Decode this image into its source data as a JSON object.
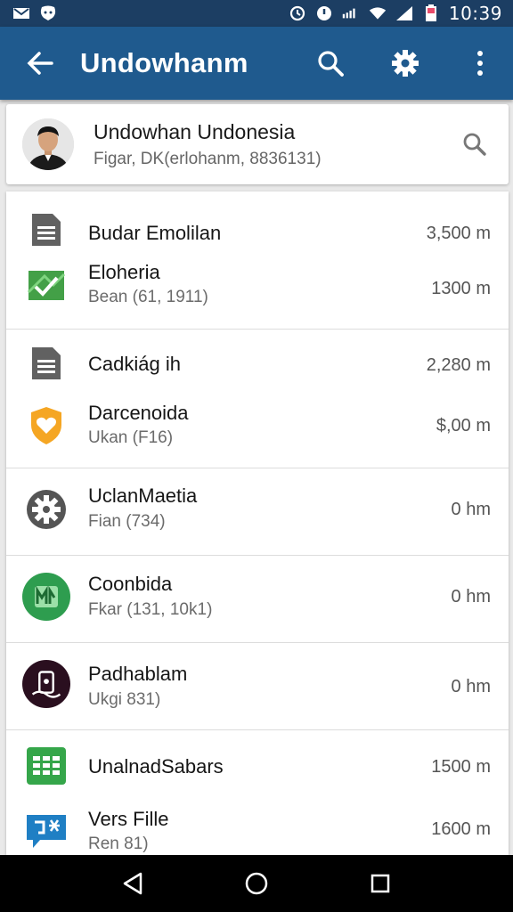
{
  "status_bar": {
    "time": "10:39",
    "left_icons": [
      "mail-icon",
      "notification-icon"
    ],
    "right_icons": [
      "alarm-icon",
      "data-icon",
      "network-speed-icon",
      "wifi-icon",
      "signal-icon",
      "battery-icon"
    ]
  },
  "app_bar": {
    "title": "Undowhanm",
    "actions": [
      "search-icon",
      "settings-icon",
      "more-vert-icon"
    ]
  },
  "profile": {
    "name": "Undowhan Undonesia",
    "subtitle": "Figar, DK(erlohanm, 8836131)"
  },
  "items": [
    {
      "label": "Budar Emolilan",
      "sub": "",
      "value": "3,500 m",
      "icon": "document-icon",
      "icon_color": "#616161"
    },
    {
      "label": "Eloheria",
      "sub": "Bean (61, 1911)",
      "value": "1300 m",
      "icon": "check-image-icon",
      "icon_color": "#43a047"
    },
    {
      "label": "Cadkiág ih",
      "sub": "",
      "value": "2,280 m",
      "icon": "document-icon",
      "icon_color": "#616161"
    },
    {
      "label": "Darcenoida",
      "sub": "Ukan (F16)",
      "value": "$,00 m",
      "icon": "heart-badge-icon",
      "icon_color": "#f5a623"
    },
    {
      "label": "UclanMaetia",
      "sub": "Fian (734)",
      "value": "0 hm",
      "icon": "gear-icon",
      "icon_color": "#555555"
    },
    {
      "label": "Coonbida",
      "sub": "Fkar (131, 10k1)",
      "value": "0 hm",
      "icon": "map-app-icon",
      "icon_color": "#2e9d4f"
    },
    {
      "label": "Padhablam",
      "sub": "Ukgi 831)",
      "value": "0 hm",
      "icon": "phone-app-icon",
      "icon_color": "#2a0f1f"
    },
    {
      "label": "UnalnadSabars",
      "sub": "",
      "value": "1500 m",
      "icon": "grid-app-icon",
      "icon_color": "#35a64a"
    },
    {
      "label": "Vers Fille",
      "sub": "Ren 81)",
      "value": "1600 m",
      "icon": "chat-bubble-icon",
      "icon_color": "#1f7fc4"
    }
  ],
  "nav_bar": [
    "back-triangle-icon",
    "home-circle-icon",
    "recents-square-icon"
  ]
}
